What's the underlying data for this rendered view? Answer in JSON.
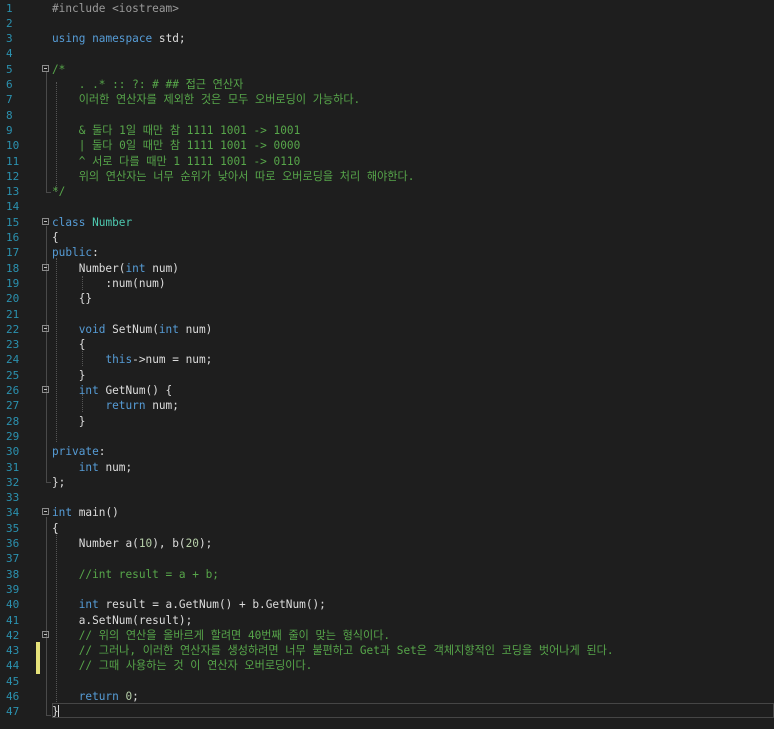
{
  "editor": {
    "language": "cpp",
    "colors": {
      "background": "#1e1e1e",
      "line_number": "#2b91af",
      "keyword": "#569cd6",
      "comment": "#57a64a",
      "number": "#b5cea8",
      "preprocessor": "#9b9b9b",
      "text": "#dcdcdc",
      "change_marker": "#e6e27a"
    },
    "lines": [
      {
        "num": "1",
        "fold": false,
        "tokens": [
          {
            "t": "#include <iostream>",
            "c": "prep"
          }
        ]
      },
      {
        "num": "2",
        "fold": false,
        "tokens": []
      },
      {
        "num": "3",
        "fold": false,
        "tokens": [
          {
            "t": "using",
            "c": "kw"
          },
          {
            "t": " ",
            "c": "plain"
          },
          {
            "t": "namespace",
            "c": "kw"
          },
          {
            "t": " std;",
            "c": "plain"
          }
        ]
      },
      {
        "num": "4",
        "fold": false,
        "tokens": []
      },
      {
        "num": "5",
        "fold": true,
        "tokens": [
          {
            "t": "/*",
            "c": "com"
          }
        ]
      },
      {
        "num": "6",
        "fold": false,
        "tokens": [
          {
            "t": "    . .* :: ?: # ## 접근 연산자",
            "c": "com"
          }
        ]
      },
      {
        "num": "7",
        "fold": false,
        "tokens": [
          {
            "t": "    이러한 연산자를 제외한 것은 모두 오버로딩이 가능하다.",
            "c": "com"
          }
        ]
      },
      {
        "num": "8",
        "fold": false,
        "tokens": []
      },
      {
        "num": "9",
        "fold": false,
        "tokens": [
          {
            "t": "    & 둘다 1일 때만 참 1111 1001 -> 1001",
            "c": "com"
          }
        ]
      },
      {
        "num": "10",
        "fold": false,
        "tokens": [
          {
            "t": "    | 둘다 0일 때만 참 1111 1001 -> 0000",
            "c": "com"
          }
        ]
      },
      {
        "num": "11",
        "fold": false,
        "tokens": [
          {
            "t": "    ^ 서로 다를 때만 1 1111 1001 -> 0110",
            "c": "com"
          }
        ]
      },
      {
        "num": "12",
        "fold": false,
        "tokens": [
          {
            "t": "    위의 연산자는 너무 순위가 낮아서 따로 오버로딩을 처리 해야한다.",
            "c": "com"
          }
        ]
      },
      {
        "num": "13",
        "fold": false,
        "tokens": [
          {
            "t": "*/",
            "c": "com"
          }
        ]
      },
      {
        "num": "14",
        "fold": false,
        "tokens": []
      },
      {
        "num": "15",
        "fold": true,
        "tokens": [
          {
            "t": "class",
            "c": "kw"
          },
          {
            "t": " ",
            "c": "plain"
          },
          {
            "t": "Number",
            "c": "type"
          }
        ]
      },
      {
        "num": "16",
        "fold": false,
        "tokens": [
          {
            "t": "{",
            "c": "plain"
          }
        ]
      },
      {
        "num": "17",
        "fold": false,
        "tokens": [
          {
            "t": "public",
            "c": "kw"
          },
          {
            "t": ":",
            "c": "plain"
          }
        ]
      },
      {
        "num": "18",
        "fold": true,
        "tokens": [
          {
            "t": "    Number(",
            "c": "plain"
          },
          {
            "t": "int",
            "c": "kw"
          },
          {
            "t": " num)",
            "c": "plain"
          }
        ]
      },
      {
        "num": "19",
        "fold": false,
        "tokens": [
          {
            "t": "        :num(num)",
            "c": "plain"
          }
        ]
      },
      {
        "num": "20",
        "fold": false,
        "tokens": [
          {
            "t": "    {}",
            "c": "plain"
          }
        ]
      },
      {
        "num": "21",
        "fold": false,
        "tokens": []
      },
      {
        "num": "22",
        "fold": true,
        "tokens": [
          {
            "t": "    ",
            "c": "plain"
          },
          {
            "t": "void",
            "c": "kw"
          },
          {
            "t": " SetNum(",
            "c": "plain"
          },
          {
            "t": "int",
            "c": "kw"
          },
          {
            "t": " num)",
            "c": "plain"
          }
        ]
      },
      {
        "num": "23",
        "fold": false,
        "tokens": [
          {
            "t": "    {",
            "c": "plain"
          }
        ]
      },
      {
        "num": "24",
        "fold": false,
        "tokens": [
          {
            "t": "        ",
            "c": "plain"
          },
          {
            "t": "this",
            "c": "kw"
          },
          {
            "t": "->num = num;",
            "c": "plain"
          }
        ]
      },
      {
        "num": "25",
        "fold": false,
        "tokens": [
          {
            "t": "    }",
            "c": "plain"
          }
        ]
      },
      {
        "num": "26",
        "fold": true,
        "tokens": [
          {
            "t": "    ",
            "c": "plain"
          },
          {
            "t": "int",
            "c": "kw"
          },
          {
            "t": " GetNum() {",
            "c": "plain"
          }
        ]
      },
      {
        "num": "27",
        "fold": false,
        "tokens": [
          {
            "t": "        ",
            "c": "plain"
          },
          {
            "t": "return",
            "c": "kw"
          },
          {
            "t": " num;",
            "c": "plain"
          }
        ]
      },
      {
        "num": "28",
        "fold": false,
        "tokens": [
          {
            "t": "    }",
            "c": "plain"
          }
        ]
      },
      {
        "num": "29",
        "fold": false,
        "tokens": []
      },
      {
        "num": "30",
        "fold": false,
        "tokens": [
          {
            "t": "private",
            "c": "kw"
          },
          {
            "t": ":",
            "c": "plain"
          }
        ]
      },
      {
        "num": "31",
        "fold": false,
        "tokens": [
          {
            "t": "    ",
            "c": "plain"
          },
          {
            "t": "int",
            "c": "kw"
          },
          {
            "t": " num;",
            "c": "plain"
          }
        ]
      },
      {
        "num": "32",
        "fold": false,
        "tokens": [
          {
            "t": "};",
            "c": "plain"
          }
        ]
      },
      {
        "num": "33",
        "fold": false,
        "tokens": []
      },
      {
        "num": "34",
        "fold": true,
        "tokens": [
          {
            "t": "int",
            "c": "kw"
          },
          {
            "t": " main()",
            "c": "plain"
          }
        ]
      },
      {
        "num": "35",
        "fold": false,
        "tokens": [
          {
            "t": "{",
            "c": "plain"
          }
        ]
      },
      {
        "num": "36",
        "fold": false,
        "tokens": [
          {
            "t": "    Number a(",
            "c": "plain"
          },
          {
            "t": "10",
            "c": "num"
          },
          {
            "t": "), b(",
            "c": "plain"
          },
          {
            "t": "20",
            "c": "num"
          },
          {
            "t": ");",
            "c": "plain"
          }
        ]
      },
      {
        "num": "37",
        "fold": false,
        "tokens": []
      },
      {
        "num": "38",
        "fold": false,
        "tokens": [
          {
            "t": "    //int result = a + b;",
            "c": "com"
          }
        ]
      },
      {
        "num": "39",
        "fold": false,
        "tokens": []
      },
      {
        "num": "40",
        "fold": false,
        "tokens": [
          {
            "t": "    ",
            "c": "plain"
          },
          {
            "t": "int",
            "c": "kw"
          },
          {
            "t": " result = a.GetNum() + b.GetNum();",
            "c": "plain"
          }
        ]
      },
      {
        "num": "41",
        "fold": false,
        "tokens": [
          {
            "t": "    a.SetNum(result);",
            "c": "plain"
          }
        ]
      },
      {
        "num": "42",
        "fold": true,
        "tokens": [
          {
            "t": "    // 위의 연산을 올바르게 할려면 40번째 줄이 맞는 형식이다.",
            "c": "com"
          }
        ]
      },
      {
        "num": "43",
        "fold": false,
        "tokens": [
          {
            "t": "    // 그러나, 이러한 연산자를 생성하려면 너무 불편하고 Get과 Set은 객체지향적인 코딩을 벗어나게 된다.",
            "c": "com"
          }
        ]
      },
      {
        "num": "44",
        "fold": false,
        "tokens": [
          {
            "t": "    // 그때 사용하는 것 이 연산자 오버로딩이다.",
            "c": "com"
          }
        ]
      },
      {
        "num": "45",
        "fold": false,
        "tokens": []
      },
      {
        "num": "46",
        "fold": false,
        "tokens": [
          {
            "t": "    ",
            "c": "plain"
          },
          {
            "t": "return",
            "c": "kw"
          },
          {
            "t": " ",
            "c": "plain"
          },
          {
            "t": "0",
            "c": "num"
          },
          {
            "t": ";",
            "c": "plain"
          }
        ]
      },
      {
        "num": "47",
        "fold": false,
        "tokens": [
          {
            "t": "}",
            "c": "plain"
          }
        ]
      }
    ]
  }
}
